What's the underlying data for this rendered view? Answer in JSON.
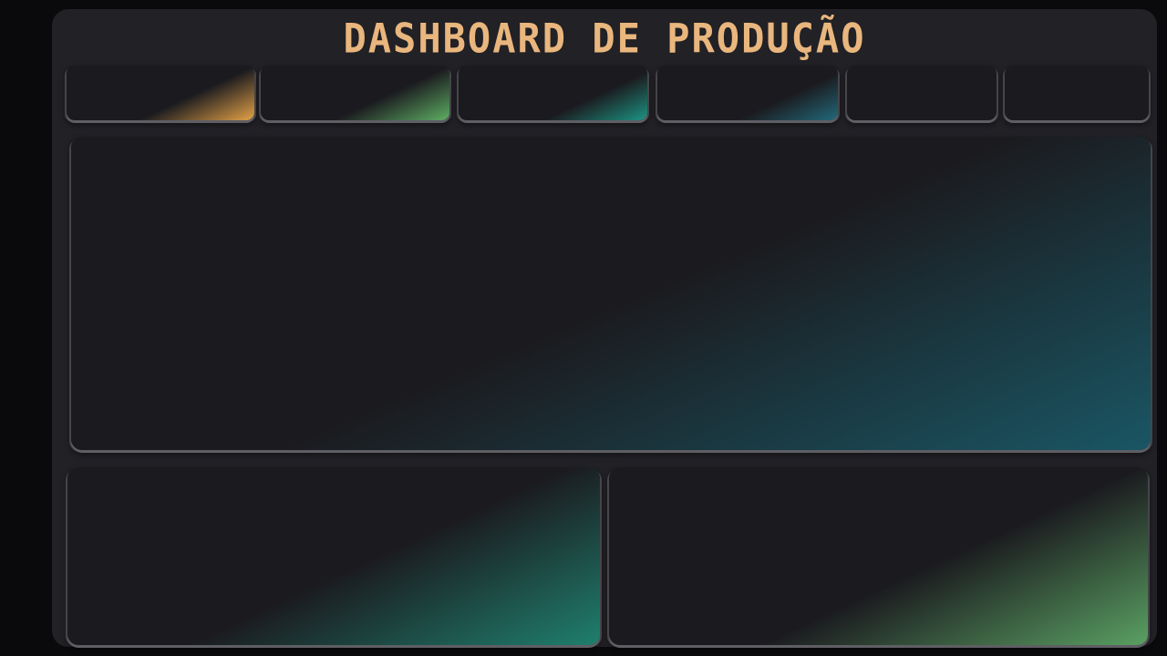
{
  "dashboard": {
    "title": "DASHBOARD DE PRODUÇÃO",
    "kpi_cards": [
      {
        "accent": "#e4a247"
      },
      {
        "accent": "#5eae63"
      },
      {
        "accent": "#1d9483"
      },
      {
        "accent": "#22697a"
      },
      {
        "accent": null
      },
      {
        "accent": null
      }
    ],
    "panels": {
      "main": {
        "accent": "#1a5664"
      },
      "bottom_left": {
        "accent": "#1f7f6e"
      },
      "bottom_right": {
        "accent": "#5aa062"
      }
    }
  },
  "colors": {
    "background": "#0a0a0d",
    "frame": "#212126",
    "card": "#1b1b1f",
    "title": "#e9b67e"
  }
}
